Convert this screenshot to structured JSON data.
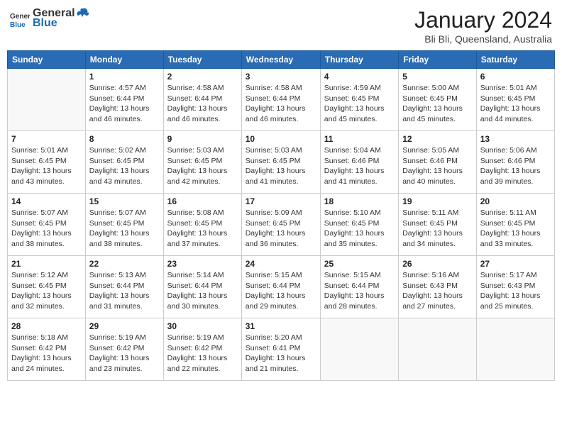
{
  "header": {
    "logo_general": "General",
    "logo_blue": "Blue",
    "month_year": "January 2024",
    "location": "Bli Bli, Queensland, Australia"
  },
  "weekdays": [
    "Sunday",
    "Monday",
    "Tuesday",
    "Wednesday",
    "Thursday",
    "Friday",
    "Saturday"
  ],
  "weeks": [
    [
      {
        "day": "",
        "info": ""
      },
      {
        "day": "1",
        "info": "Sunrise: 4:57 AM\nSunset: 6:44 PM\nDaylight: 13 hours\nand 46 minutes."
      },
      {
        "day": "2",
        "info": "Sunrise: 4:58 AM\nSunset: 6:44 PM\nDaylight: 13 hours\nand 46 minutes."
      },
      {
        "day": "3",
        "info": "Sunrise: 4:58 AM\nSunset: 6:44 PM\nDaylight: 13 hours\nand 46 minutes."
      },
      {
        "day": "4",
        "info": "Sunrise: 4:59 AM\nSunset: 6:45 PM\nDaylight: 13 hours\nand 45 minutes."
      },
      {
        "day": "5",
        "info": "Sunrise: 5:00 AM\nSunset: 6:45 PM\nDaylight: 13 hours\nand 45 minutes."
      },
      {
        "day": "6",
        "info": "Sunrise: 5:01 AM\nSunset: 6:45 PM\nDaylight: 13 hours\nand 44 minutes."
      }
    ],
    [
      {
        "day": "7",
        "info": "Sunrise: 5:01 AM\nSunset: 6:45 PM\nDaylight: 13 hours\nand 43 minutes."
      },
      {
        "day": "8",
        "info": "Sunrise: 5:02 AM\nSunset: 6:45 PM\nDaylight: 13 hours\nand 43 minutes."
      },
      {
        "day": "9",
        "info": "Sunrise: 5:03 AM\nSunset: 6:45 PM\nDaylight: 13 hours\nand 42 minutes."
      },
      {
        "day": "10",
        "info": "Sunrise: 5:03 AM\nSunset: 6:45 PM\nDaylight: 13 hours\nand 41 minutes."
      },
      {
        "day": "11",
        "info": "Sunrise: 5:04 AM\nSunset: 6:46 PM\nDaylight: 13 hours\nand 41 minutes."
      },
      {
        "day": "12",
        "info": "Sunrise: 5:05 AM\nSunset: 6:46 PM\nDaylight: 13 hours\nand 40 minutes."
      },
      {
        "day": "13",
        "info": "Sunrise: 5:06 AM\nSunset: 6:46 PM\nDaylight: 13 hours\nand 39 minutes."
      }
    ],
    [
      {
        "day": "14",
        "info": "Sunrise: 5:07 AM\nSunset: 6:45 PM\nDaylight: 13 hours\nand 38 minutes."
      },
      {
        "day": "15",
        "info": "Sunrise: 5:07 AM\nSunset: 6:45 PM\nDaylight: 13 hours\nand 38 minutes."
      },
      {
        "day": "16",
        "info": "Sunrise: 5:08 AM\nSunset: 6:45 PM\nDaylight: 13 hours\nand 37 minutes."
      },
      {
        "day": "17",
        "info": "Sunrise: 5:09 AM\nSunset: 6:45 PM\nDaylight: 13 hours\nand 36 minutes."
      },
      {
        "day": "18",
        "info": "Sunrise: 5:10 AM\nSunset: 6:45 PM\nDaylight: 13 hours\nand 35 minutes."
      },
      {
        "day": "19",
        "info": "Sunrise: 5:11 AM\nSunset: 6:45 PM\nDaylight: 13 hours\nand 34 minutes."
      },
      {
        "day": "20",
        "info": "Sunrise: 5:11 AM\nSunset: 6:45 PM\nDaylight: 13 hours\nand 33 minutes."
      }
    ],
    [
      {
        "day": "21",
        "info": "Sunrise: 5:12 AM\nSunset: 6:45 PM\nDaylight: 13 hours\nand 32 minutes."
      },
      {
        "day": "22",
        "info": "Sunrise: 5:13 AM\nSunset: 6:44 PM\nDaylight: 13 hours\nand 31 minutes."
      },
      {
        "day": "23",
        "info": "Sunrise: 5:14 AM\nSunset: 6:44 PM\nDaylight: 13 hours\nand 30 minutes."
      },
      {
        "day": "24",
        "info": "Sunrise: 5:15 AM\nSunset: 6:44 PM\nDaylight: 13 hours\nand 29 minutes."
      },
      {
        "day": "25",
        "info": "Sunrise: 5:15 AM\nSunset: 6:44 PM\nDaylight: 13 hours\nand 28 minutes."
      },
      {
        "day": "26",
        "info": "Sunrise: 5:16 AM\nSunset: 6:43 PM\nDaylight: 13 hours\nand 27 minutes."
      },
      {
        "day": "27",
        "info": "Sunrise: 5:17 AM\nSunset: 6:43 PM\nDaylight: 13 hours\nand 25 minutes."
      }
    ],
    [
      {
        "day": "28",
        "info": "Sunrise: 5:18 AM\nSunset: 6:42 PM\nDaylight: 13 hours\nand 24 minutes."
      },
      {
        "day": "29",
        "info": "Sunrise: 5:19 AM\nSunset: 6:42 PM\nDaylight: 13 hours\nand 23 minutes."
      },
      {
        "day": "30",
        "info": "Sunrise: 5:19 AM\nSunset: 6:42 PM\nDaylight: 13 hours\nand 22 minutes."
      },
      {
        "day": "31",
        "info": "Sunrise: 5:20 AM\nSunset: 6:41 PM\nDaylight: 13 hours\nand 21 minutes."
      },
      {
        "day": "",
        "info": ""
      },
      {
        "day": "",
        "info": ""
      },
      {
        "day": "",
        "info": ""
      }
    ]
  ]
}
